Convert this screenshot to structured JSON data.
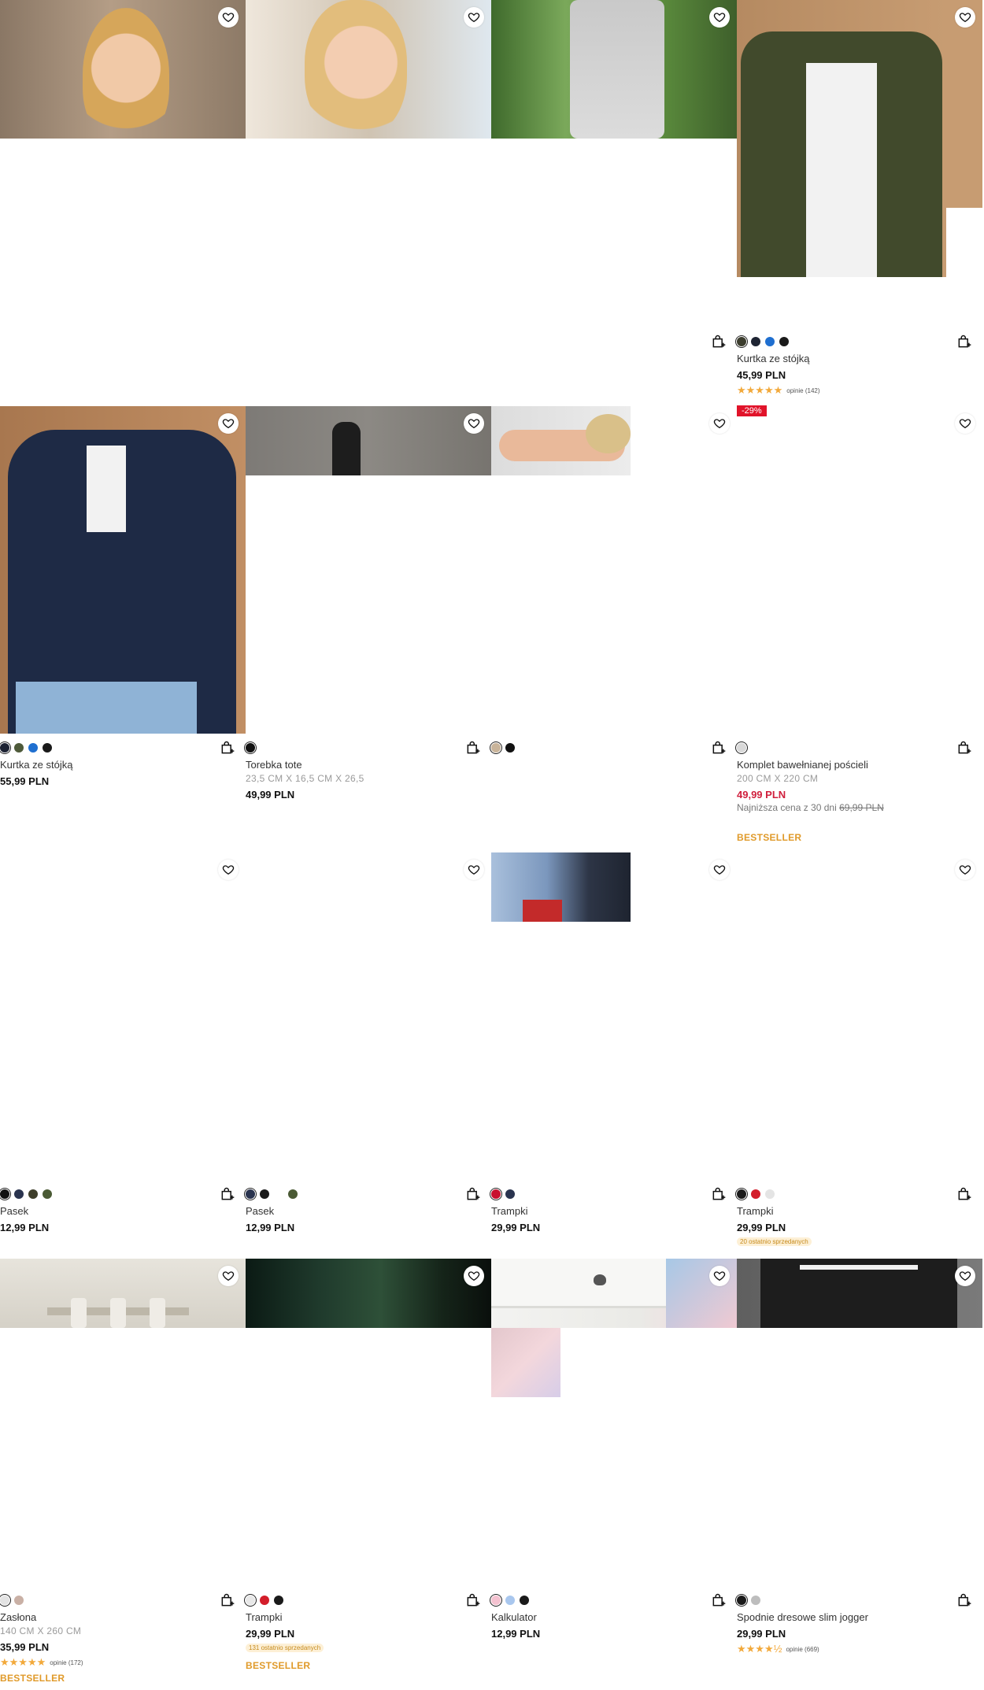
{
  "ui": {
    "favorite_icon": "heart-icon",
    "cart_icon": "add-to-cart-bag-icon"
  },
  "products": [
    {
      "id": "p1",
      "name": "",
      "price": "",
      "colors": []
    },
    {
      "id": "p2",
      "name": "",
      "price": "",
      "colors": []
    },
    {
      "id": "p3",
      "name": "",
      "price": "",
      "colors": []
    },
    {
      "id": "p4",
      "name": "Kurtka ze stójką",
      "price": "45,99 PLN",
      "colors": [
        "#3c3d2e",
        "#1e2433",
        "#1f6fd0",
        "#1a1a1a"
      ],
      "rating": 4.5,
      "reviews": "opinie (142)",
      "discount": "-29%"
    },
    {
      "id": "p5",
      "name": "Kurtka ze stójką",
      "price": "55,99 PLN",
      "colors": [
        "#1c2233",
        "#4e5a3a",
        "#1f6fd0",
        "#1a1a1a"
      ]
    },
    {
      "id": "p6",
      "name": "Torebka tote",
      "size": "23,5 CM X 16,5 CM X 26,5",
      "price": "49,99 PLN",
      "colors": [
        "#111111"
      ]
    },
    {
      "id": "p7",
      "name": "",
      "price": "",
      "colors": [
        "#c9b49a",
        "#111111"
      ]
    },
    {
      "id": "p8",
      "name": "Komplet bawełnianej pościeli",
      "size": "200 CM X 220 CM",
      "price": "49,99 PLN",
      "lowest_label": "Najniższa cena z 30 dni",
      "lowest_price": "69,99 PLN",
      "badge": "BESTSELLER",
      "colors": [
        "#d9d9d9"
      ]
    },
    {
      "id": "p9",
      "name": "Pasek",
      "price": "12,99 PLN",
      "colors": [
        "#111111",
        "#2a344f",
        "#3e3e2a",
        "#4a5a34"
      ]
    },
    {
      "id": "p10",
      "name": "Pasek",
      "price": "12,99 PLN",
      "colors": [
        "#2a344f",
        "#1a1a1a",
        "#ffffff",
        "#4a5a34"
      ]
    },
    {
      "id": "p11",
      "name": "Trampki",
      "price": "29,99 PLN",
      "colors": [
        "#c8102e",
        "#2a344f"
      ]
    },
    {
      "id": "p12",
      "name": "Trampki",
      "price": "29,99 PLN",
      "low_stock": "20 ostatnio sprzedanych",
      "colors": [
        "#1a1a1a",
        "#d31d2a",
        "#e4e4e4"
      ]
    },
    {
      "id": "p13",
      "name": "Zasłona",
      "size": "140 CM X 260 CM",
      "price": "35,99 PLN",
      "rating": 5,
      "reviews": "opinie (172)",
      "badge": "BESTSELLER",
      "colors": [
        "#e3e3e3",
        "#c9b0a5"
      ]
    },
    {
      "id": "p14",
      "name": "Trampki",
      "price": "29,99 PLN",
      "low_stock": "131 ostatnio sprzedanych",
      "badge": "BESTSELLER",
      "colors": [
        "#e8e8e8",
        "#d31d2a",
        "#1a1a1a"
      ]
    },
    {
      "id": "p15",
      "name": "Kalkulator",
      "price": "12,99 PLN",
      "colors": [
        "#f4c2d0",
        "#a9c7ee",
        "#1a1a1a"
      ]
    },
    {
      "id": "p16",
      "name": "Spodnie dresowe slim jogger",
      "price": "29,99 PLN",
      "rating": 4.5,
      "reviews": "opinie (669)",
      "colors": [
        "#1a1a1a",
        "#bdbdbd"
      ]
    }
  ]
}
